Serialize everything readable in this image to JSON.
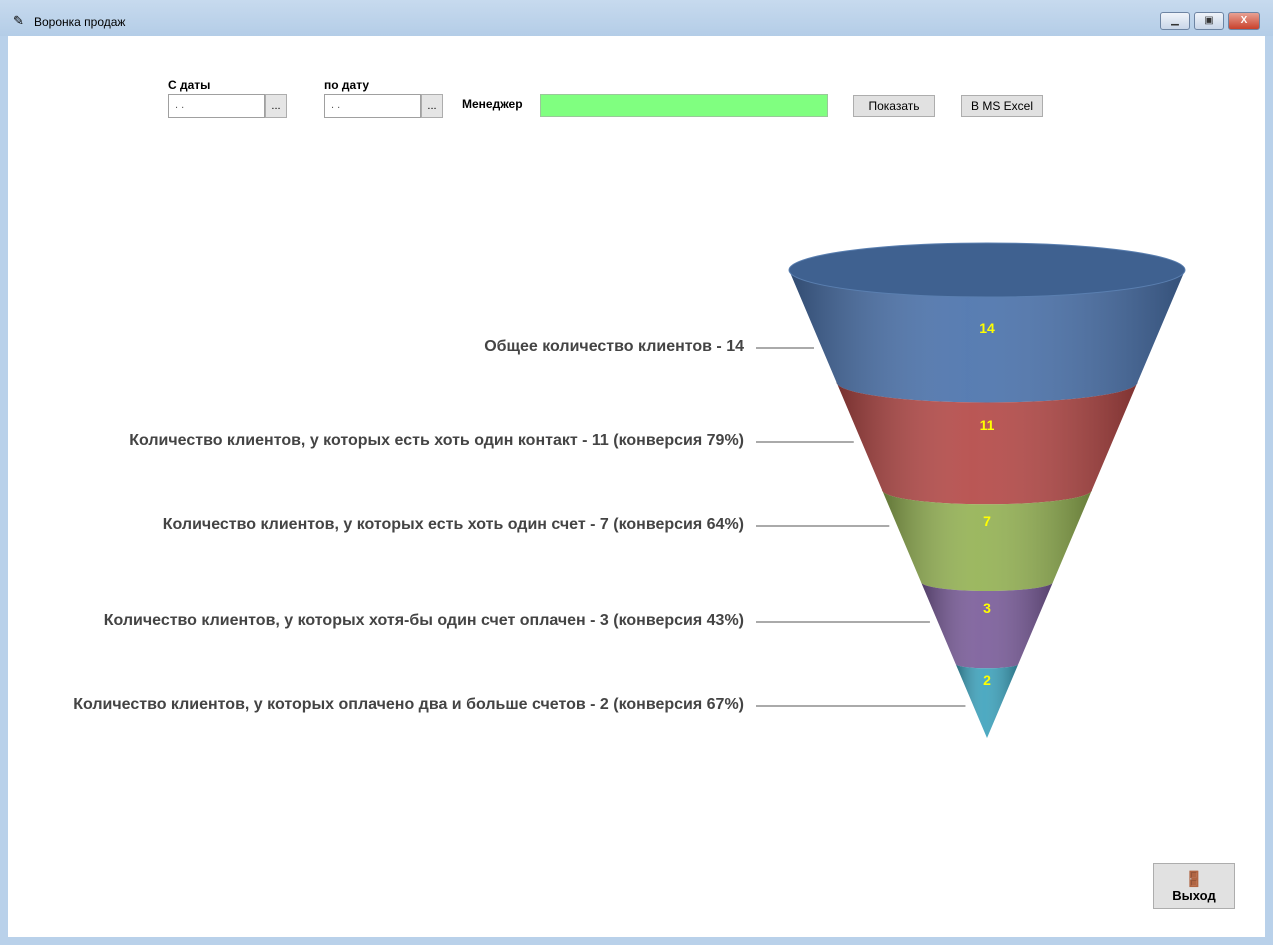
{
  "window": {
    "title": "Воронка продаж"
  },
  "filters": {
    "from_label": "С даты",
    "from_value": " .  .",
    "to_label": "по дату",
    "to_value": " .  .",
    "picker_label": "...",
    "manager_label": "Менеджер",
    "manager_value": ""
  },
  "buttons": {
    "show": "Показать",
    "excel": "В MS Excel",
    "exit": "Выход"
  },
  "chart_data": {
    "type": "funnel",
    "stages": [
      {
        "label": "Общее количество клиентов - 14",
        "value": 14,
        "color": "#4a72ac"
      },
      {
        "label": "Количество клиентов, у которых есть хоть один контакт - 11 (конверсия 79%)",
        "value": 11,
        "color": "#b44846"
      },
      {
        "label": "Количество клиентов, у которых есть хоть один счет - 7 (конверсия 64%)",
        "value": 7,
        "color": "#94b253"
      },
      {
        "label": "Количество клиентов, у которых хотя-бы один счет оплачен - 3 (конверсия 43%)",
        "value": 3,
        "color": "#7a5c9a"
      },
      {
        "label": "Количество клиентов, у которых оплачено два и больше счетов - 2 (конверсия 67%)",
        "value": 2,
        "color": "#3ea3bd"
      }
    ],
    "value_color": "#ffff00"
  }
}
